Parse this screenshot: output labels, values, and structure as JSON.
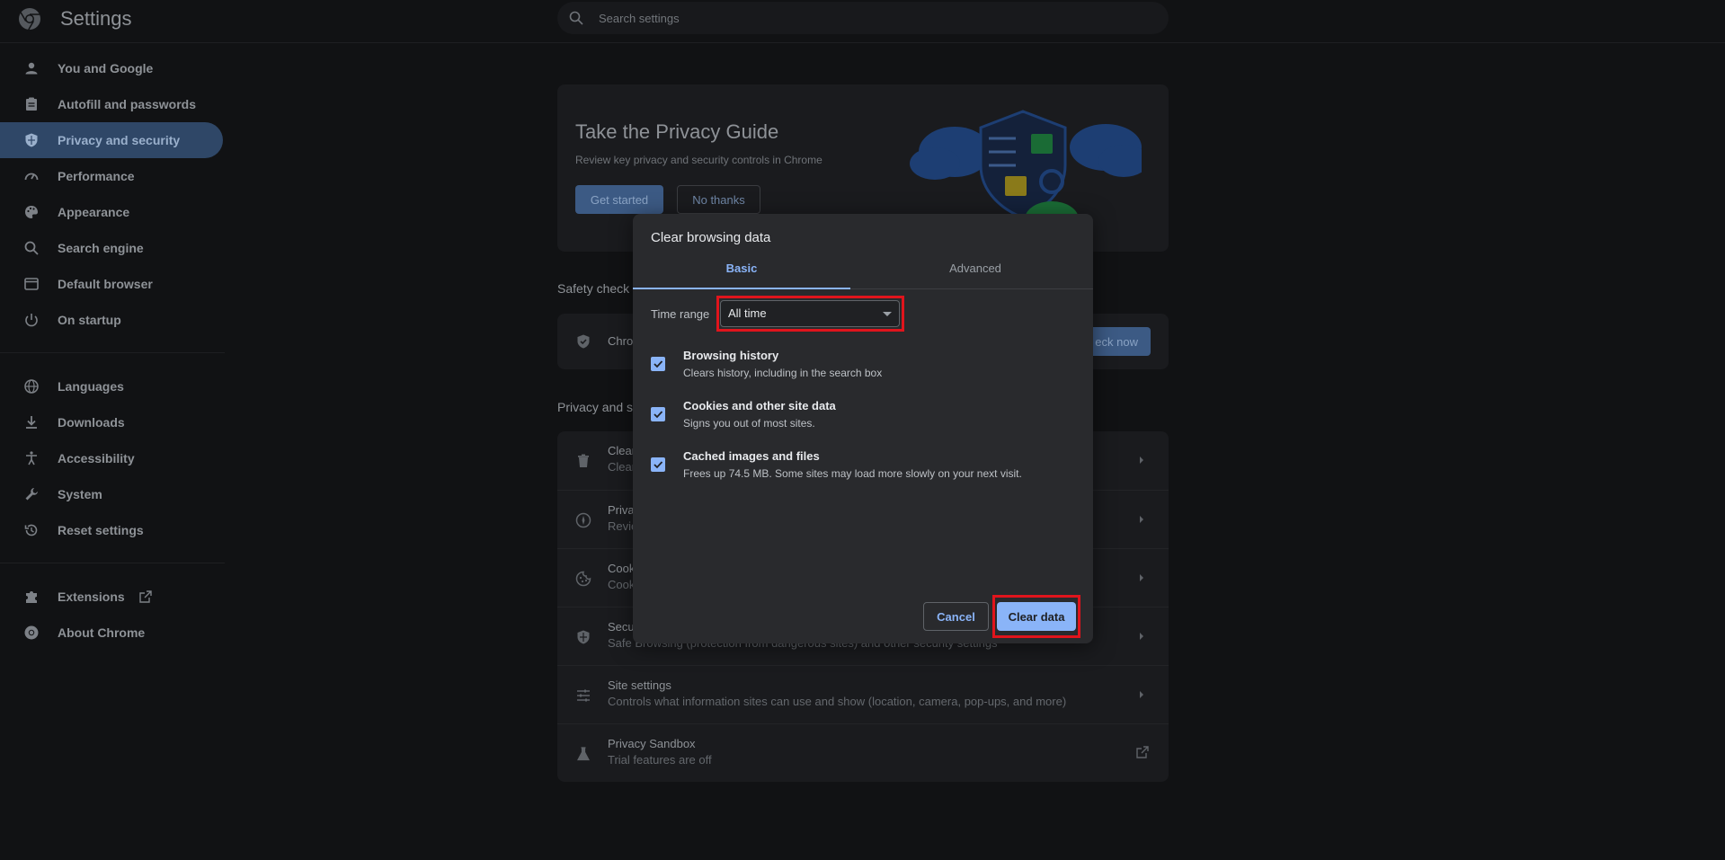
{
  "header": {
    "app_title": "Settings",
    "search_placeholder": "Search settings"
  },
  "sidebar": {
    "items": [
      {
        "label": "You and Google",
        "icon": "person-icon"
      },
      {
        "label": "Autofill and passwords",
        "icon": "clipboard-icon"
      },
      {
        "label": "Privacy and security",
        "icon": "shield-icon",
        "active": true
      },
      {
        "label": "Performance",
        "icon": "speedometer-icon"
      },
      {
        "label": "Appearance",
        "icon": "palette-icon"
      },
      {
        "label": "Search engine",
        "icon": "search-icon"
      },
      {
        "label": "Default browser",
        "icon": "browser-icon"
      },
      {
        "label": "On startup",
        "icon": "power-icon"
      },
      {
        "label": "Languages",
        "icon": "globe-icon"
      },
      {
        "label": "Downloads",
        "icon": "download-icon"
      },
      {
        "label": "Accessibility",
        "icon": "accessibility-icon"
      },
      {
        "label": "System",
        "icon": "wrench-icon"
      },
      {
        "label": "Reset settings",
        "icon": "history-icon"
      },
      {
        "label": "Extensions",
        "icon": "puzzle-icon"
      },
      {
        "label": "About Chrome",
        "icon": "chrome-icon"
      }
    ]
  },
  "privacy_guide": {
    "title": "Take the Privacy Guide",
    "subtitle": "Review key privacy and security controls in Chrome",
    "get_started": "Get started",
    "no_thanks": "No thanks"
  },
  "safety_check": {
    "label": "Safety check",
    "row_title": "Chro",
    "button": "eck now"
  },
  "privacy_section": {
    "label": "Privacy and s",
    "rows": [
      {
        "title": "Clear",
        "subtitle": "Clear",
        "icon": "trash-icon"
      },
      {
        "title": "Priva",
        "subtitle": "Revie",
        "icon": "compass-icon"
      },
      {
        "title": "Cook",
        "subtitle": "Cook",
        "icon": "cookie-icon"
      },
      {
        "title": "Secu",
        "subtitle": "Safe Browsing (protection from dangerous sites) and other security settings",
        "icon": "shield-icon"
      },
      {
        "title": "Site settings",
        "subtitle": "Controls what information sites can use and show (location, camera, pop-ups, and more)",
        "icon": "sliders-icon"
      },
      {
        "title": "Privacy Sandbox",
        "subtitle": "Trial features are off",
        "icon": "flask-icon"
      }
    ]
  },
  "dialog": {
    "title": "Clear browsing data",
    "tabs": [
      "Basic",
      "Advanced"
    ],
    "time_range_label": "Time range",
    "time_range_value": "All time",
    "options": [
      {
        "title": "Browsing history",
        "subtitle": "Clears history, including in the search box",
        "checked": true
      },
      {
        "title": "Cookies and other site data",
        "subtitle": "Signs you out of most sites.",
        "checked": true
      },
      {
        "title": "Cached images and files",
        "subtitle": "Frees up 74.5 MB. Some sites may load more slowly on your next visit.",
        "checked": true
      }
    ],
    "cancel": "Cancel",
    "clear": "Clear data"
  },
  "colors": {
    "accent": "#8ab4f8",
    "highlight": "#e0141c",
    "active_nav": "#2f4767"
  }
}
